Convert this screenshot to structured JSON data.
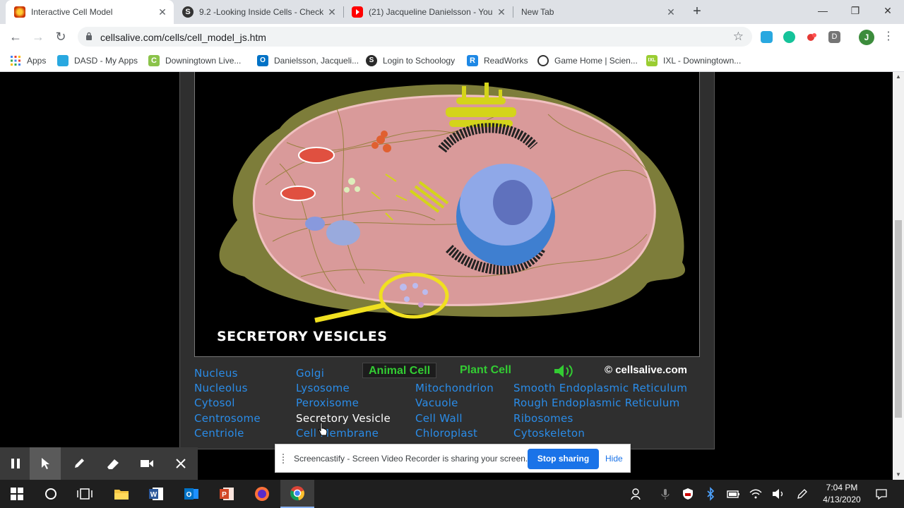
{
  "browser": {
    "tabs": [
      {
        "title": "Interactive Cell Model",
        "active": true,
        "favicon_color": "#d2691e"
      },
      {
        "title": "9.2 -Looking Inside Cells - Check",
        "active": false,
        "favicon_color": "#333333"
      },
      {
        "title": "(21) Jacqueline Danielsson - You",
        "active": false,
        "favicon_color": "#ff0000"
      },
      {
        "title": "New Tab",
        "active": false,
        "favicon_color": ""
      }
    ],
    "url": "cellsalive.com/cells/cell_model_js.htm",
    "profile_initial": "J",
    "extension_initial": "D",
    "bookmarks": [
      {
        "label": "Apps",
        "icon_color": "#4285f4"
      },
      {
        "label": "DASD - My Apps",
        "icon_color": "#29a8e0"
      },
      {
        "label": "Downingtown Live...",
        "icon_color": "#8bc34a"
      },
      {
        "label": "Danielsson, Jacqueli...",
        "icon_color": "#0072c6"
      },
      {
        "label": "Login to Schoology",
        "icon_color": "#2a2a2a"
      },
      {
        "label": "ReadWorks",
        "icon_color": "#1e88e5"
      },
      {
        "label": "Game Home | Scien...",
        "icon_color": "#333333"
      },
      {
        "label": "IXL - Downingtown...",
        "icon_color": "#9acd32"
      }
    ]
  },
  "cell_model": {
    "current_label": "SECRETORY VESICLES",
    "cell_types": [
      "Animal Cell",
      "Plant Cell"
    ],
    "selected_cell_type": "Animal Cell",
    "copyright": "© cellsalive.com",
    "accent_color": "#33cc33",
    "link_color": "#2a8ce8",
    "organelles": {
      "col1": [
        "Nucleus",
        "Nucleolus",
        "Cytosol",
        "Centrosome",
        "Centriole"
      ],
      "col2": [
        "Golgi",
        "Lysosome",
        "Peroxisome",
        "Secretory Vesicle",
        "Cell Membrane"
      ],
      "col3": [
        "Mitochondrion",
        "Vacuole",
        "Cell Wall",
        "Chloroplast"
      ],
      "col4": [
        "Smooth Endoplasmic Reticulum",
        "Rough Endoplasmic Reticulum",
        "Ribosomes",
        "Cytoskeleton"
      ]
    },
    "selected_organelle": "Secretory Vesicle"
  },
  "screencastify": {
    "message": "Screencastify - Screen Video Recorder is sharing your screen.",
    "stop_label": "Stop sharing",
    "hide_label": "Hide"
  },
  "taskbar": {
    "time": "7:04 PM",
    "date": "4/13/2020"
  }
}
